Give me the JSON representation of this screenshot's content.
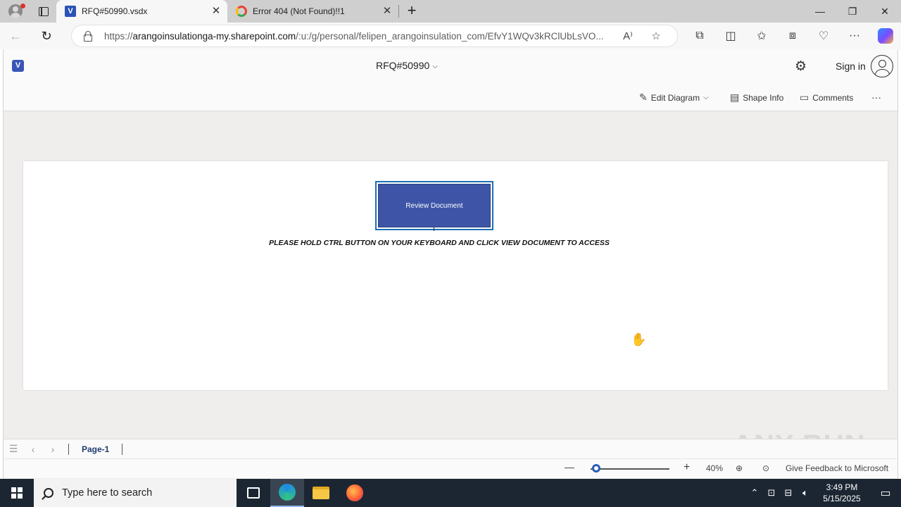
{
  "browser": {
    "tabs": [
      {
        "title": "RFQ#50990.vsdx",
        "favicon": "visio-icon",
        "active": true
      },
      {
        "title": "Error 404 (Not Found)!!1",
        "favicon": "google-icon",
        "active": false
      }
    ],
    "address": {
      "url_prefix": "https://",
      "url_host": "arangoinsulationga-my.sharepoint.com",
      "url_path": "/:u:/g/personal/felipen_arangoinsulation_com/EfvY1WQv3kRClUbLsVO..."
    }
  },
  "visio": {
    "doc_title": "RFQ#50990",
    "sign_in_label": "Sign in",
    "ribbon": {
      "edit_diagram": "Edit Diagram",
      "shape_info": "Shape Info",
      "comments": "Comments",
      "more": "···"
    },
    "canvas": {
      "shape_text": "Review Document",
      "instruction": "PLEASE HOLD CTRL BUTTON ON YOUR KEYBOARD AND CLICK VIEW DOCUMENT TO ACCESS"
    },
    "pagebar": {
      "page_tab": "Page-1"
    },
    "statusbar": {
      "zoom_level": "40%",
      "zoom_fraction": 0.02,
      "feedback": "Give Feedback to Microsoft"
    },
    "watermark": "ANY RUN"
  },
  "taskbar": {
    "search_placeholder": "Type here to search",
    "time": "3:49 PM",
    "date": "5/15/2025"
  },
  "colors": {
    "accent": "#2b5fb4",
    "shape_fill": "#3e55a7",
    "shape_border": "#1d6fb5",
    "taskbar": "#1c2633"
  }
}
